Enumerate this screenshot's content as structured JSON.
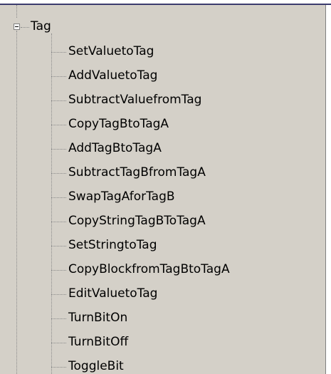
{
  "tree": {
    "root": {
      "label": "Tag",
      "expander_icon": "minus-box-icon"
    },
    "items": [
      {
        "label": "SetValuetoTag"
      },
      {
        "label": "AddValuetoTag"
      },
      {
        "label": "SubtractValuefromTag"
      },
      {
        "label": "CopyTagBtoTagA"
      },
      {
        "label": "AddTagBtoTagA"
      },
      {
        "label": "SubtractTagBfromTagA"
      },
      {
        "label": "SwapTagAforTagB"
      },
      {
        "label": "CopyStringTagBToTagA"
      },
      {
        "label": "SetStringtoTag"
      },
      {
        "label": "CopyBlockfromTagBtoTagA"
      },
      {
        "label": "EditValuetoTag"
      },
      {
        "label": "TurnBitOn"
      },
      {
        "label": "TurnBitOff"
      },
      {
        "label": "ToggleBit"
      }
    ]
  }
}
